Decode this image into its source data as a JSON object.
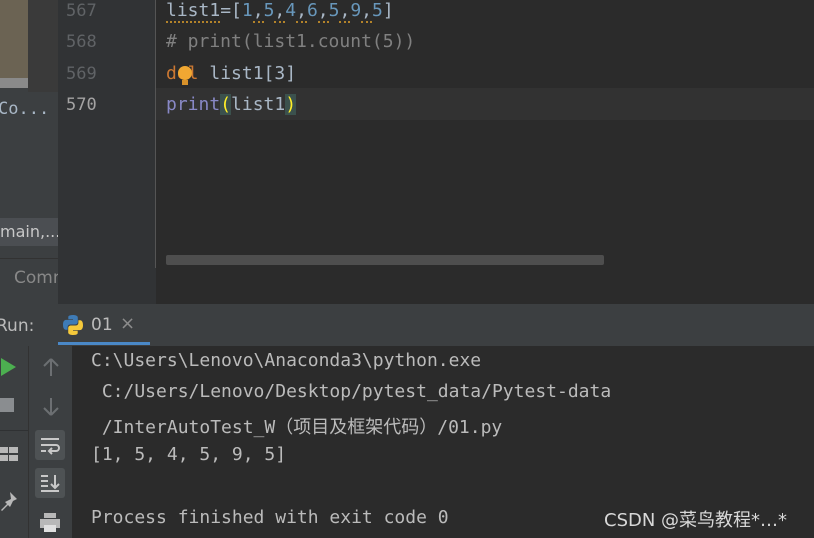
{
  "left_panel": {
    "project_label": "Co...",
    "tab_label": "main,...",
    "commit_label": "Comm"
  },
  "editor": {
    "line_numbers": [
      "567",
      "568",
      "569",
      "570"
    ],
    "lines": {
      "l567": {
        "name": "list1",
        "op": "=[",
        "items": [
          "1",
          "5",
          "4",
          "6",
          "5",
          "9",
          "5"
        ],
        "close": "]"
      },
      "l568": {
        "text": "# print(list1.count(5))"
      },
      "l569": {
        "kw": "del",
        "rest": " list1[3]"
      },
      "l570": {
        "fn": "print",
        "open": "(",
        "arg": "list1",
        "close": ")"
      }
    }
  },
  "run": {
    "label": "Run:",
    "tab_name": "01",
    "tab_close": "×",
    "output": [
      "C:\\Users\\Lenovo\\Anaconda3\\python.exe",
      " C:/Users/Lenovo/Desktop/pytest_data/Pytest-data",
      " /InterAutoTest_W（项目及框架代码）/01.py",
      "[1, 5, 4, 5, 9, 5]",
      "",
      "Process finished with exit code 0"
    ]
  },
  "watermark": "CSDN @菜鸟教程*…*",
  "colors": {
    "keyword": "#cc7832",
    "number": "#6897bb",
    "comment": "#808080",
    "builtin": "#8888c6",
    "run_green": "#4caf50"
  }
}
